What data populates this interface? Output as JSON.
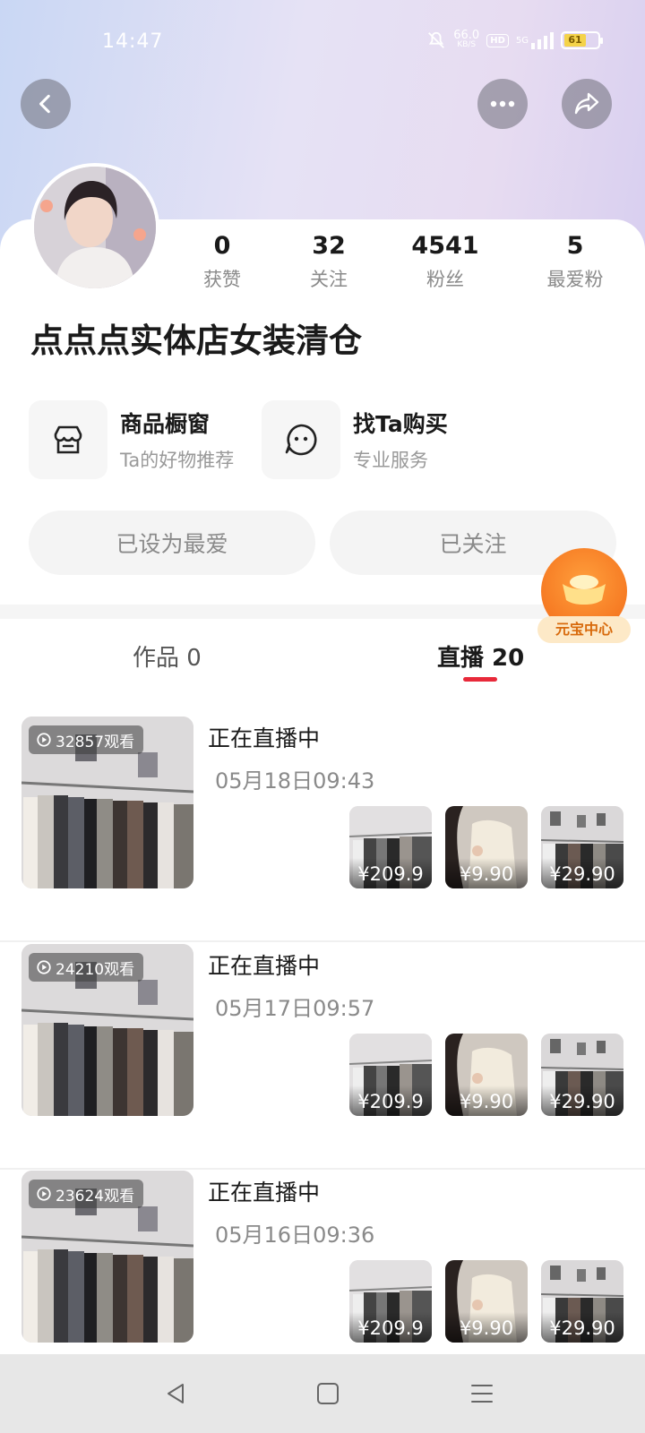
{
  "status": {
    "time": "14:47",
    "net_speed": "66.0",
    "net_unit": "KB/S",
    "hd": "HD",
    "signal": "5G",
    "battery": "61"
  },
  "icons": {
    "back": "chevron-left-icon",
    "more": "more-dots-icon",
    "share": "share-icon",
    "store": "store-icon",
    "chat": "chat-face-icon",
    "replay": "replay-icon"
  },
  "stats": [
    {
      "value": "0",
      "label": "获赞"
    },
    {
      "value": "32",
      "label": "关注"
    },
    {
      "value": "4541",
      "label": "粉丝"
    },
    {
      "value": "5",
      "label": "最爱粉"
    }
  ],
  "profile": {
    "name": "点点点实体店女装清仓"
  },
  "features": [
    {
      "title": "商品橱窗",
      "subtitle": "Ta的好物推荐"
    },
    {
      "title": "找Ta购买",
      "subtitle": "专业服务"
    }
  ],
  "buttons": {
    "favorite": "已设为最爱",
    "following": "已关注"
  },
  "yuanbao": {
    "label": "元宝中心"
  },
  "tabs": [
    {
      "label": "作品 0"
    },
    {
      "label": "直播 20"
    }
  ],
  "colors": {
    "accent": "#e8293a",
    "orange": "#f26a18"
  },
  "lives": [
    {
      "views": "32857观看",
      "title": "正在直播中",
      "date": "05月18日09:43",
      "prices": [
        "¥209.9",
        "¥9.90",
        "¥29.90"
      ]
    },
    {
      "views": "24210观看",
      "title": "正在直播中",
      "date": "05月17日09:57",
      "prices": [
        "¥209.9",
        "¥9.90",
        "¥29.90"
      ]
    },
    {
      "views": "23624观看",
      "title": "正在直播中",
      "date": "05月16日09:36",
      "prices": [
        "¥209.9",
        "¥9.90",
        "¥29.90"
      ]
    }
  ]
}
